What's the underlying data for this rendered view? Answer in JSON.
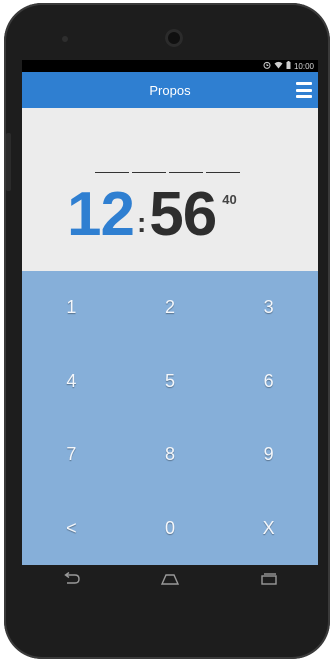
{
  "status_bar": {
    "icons": [
      "alarm-icon",
      "wifi-icon",
      "battery-icon"
    ],
    "time": "10:00"
  },
  "app_bar": {
    "title": "Propos",
    "menu_icon": "hamburger-menu-icon",
    "color": "#2f7fd1"
  },
  "time_display": {
    "hours": "12",
    "separator": ":",
    "minutes": "56",
    "seconds": "40",
    "hours_color": "#2f7fd1",
    "minutes_color": "#2e2e2e"
  },
  "keypad": {
    "background": "#86afd9",
    "keys": [
      "1",
      "2",
      "3",
      "4",
      "5",
      "6",
      "7",
      "8",
      "9",
      "<",
      "0",
      "X"
    ]
  },
  "nav_bar": {
    "buttons": [
      "back-icon",
      "home-icon",
      "recent-apps-icon"
    ]
  }
}
